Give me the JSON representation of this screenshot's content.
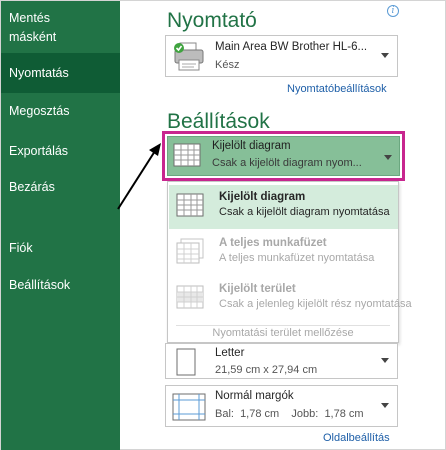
{
  "sidebar": {
    "items": [
      {
        "label_line1": "Mentés",
        "label_line2": "másként"
      },
      {
        "label": "Nyomtatás"
      },
      {
        "label": "Megosztás"
      },
      {
        "label": "Exportálás"
      },
      {
        "label": "Bezárás"
      },
      {
        "label": "Fiók"
      },
      {
        "label": "Beállítások"
      }
    ]
  },
  "printer_section": {
    "title": "Nyomtató",
    "info_icon": "i",
    "printer_name": "Main Area BW Brother HL-6...",
    "printer_status": "Kész",
    "properties_link": "Nyomtatóbeállítások"
  },
  "settings_section": {
    "title": "Beállítások",
    "selected": {
      "main": "Kijelölt diagram",
      "sub": "Csak a kijelölt diagram nyom..."
    },
    "options": [
      {
        "title": "Kijelölt diagram",
        "sub": "Csak a kijelölt diagram nyomtatása",
        "state": "active"
      },
      {
        "title": "A teljes munkafüzet",
        "sub": "A teljes munkafüzet nyomtatása",
        "state": "disabled"
      },
      {
        "title": "Kijelölt terület",
        "sub": "Csak a jelenleg kijelölt rész nyomtatása",
        "state": "disabled"
      }
    ],
    "ignore_print_area": "Nyomtatási terület mellőzése",
    "paper": {
      "main": "Letter",
      "sub": "21,59 cm x 27,94 cm"
    },
    "margins": {
      "main": "Normál margók",
      "sub": "Bal:  1,78 cm    Jobb:  1,78 cm"
    },
    "page_setup_link": "Oldalbeállítás"
  },
  "colors": {
    "sidebar": "#217346",
    "sidebar_selected": "#0f5c35",
    "accent_title": "#217346",
    "highlight_border": "#c8268f",
    "selected_fill": "#86bf98",
    "link": "#1e5fa8"
  }
}
